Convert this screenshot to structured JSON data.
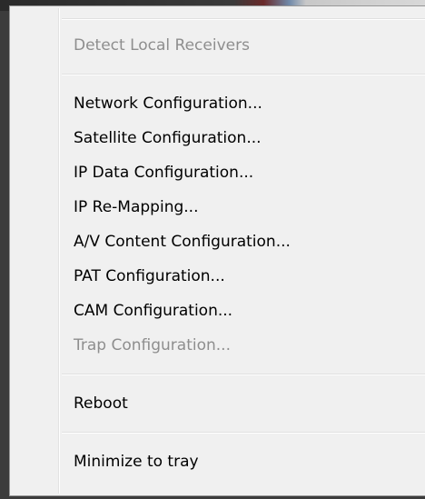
{
  "menu": {
    "items": [
      {
        "label": "Detect Local Receivers",
        "disabled": true
      },
      {
        "label": "Network Configuration...",
        "disabled": false
      },
      {
        "label": "Satellite Configuration...",
        "disabled": false
      },
      {
        "label": "IP Data Configuration...",
        "disabled": false
      },
      {
        "label": "IP Re-Mapping...",
        "disabled": false
      },
      {
        "label": "A/V Content Configuration...",
        "disabled": false
      },
      {
        "label": "PAT Configuration...",
        "disabled": false
      },
      {
        "label": "CAM Configuration...",
        "disabled": false
      },
      {
        "label": "Trap Configuration...",
        "disabled": true
      },
      {
        "label": "Reboot",
        "disabled": false
      },
      {
        "label": "Minimize to tray",
        "disabled": false
      }
    ]
  }
}
